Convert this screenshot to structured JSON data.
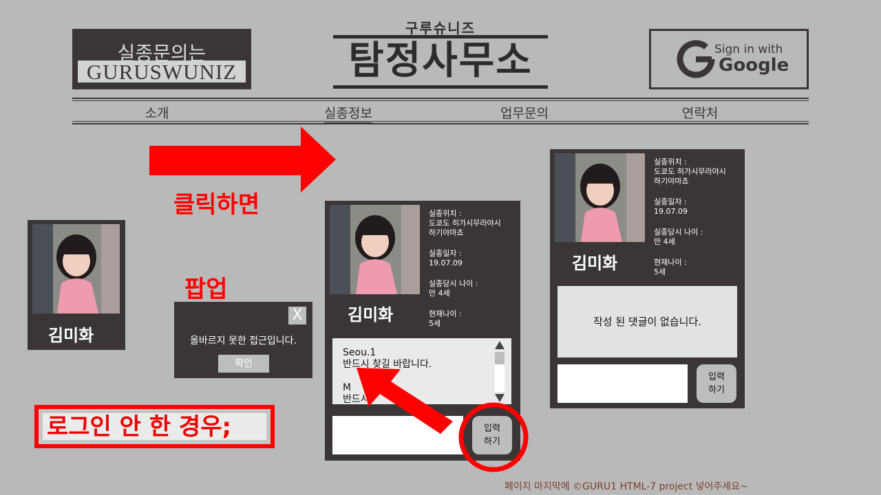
{
  "header": {
    "logo_line1": "실종문의는",
    "logo_line2": "GURUSWUNIZ",
    "brand_subtitle": "구루슈니즈",
    "brand_title": "탐정사무소",
    "signin_line1": "Sign in with",
    "signin_line2": "Google"
  },
  "nav": [
    "소개",
    "실종정보",
    "업무문의",
    "연락처"
  ],
  "annotations": {
    "click_label": "클릭하면",
    "popup_label": "팝업",
    "not_logged_in_label": "로그인 안 한 경우;"
  },
  "small_card": {
    "name": "김미화"
  },
  "popup": {
    "close_label": "X",
    "message": "올바르지 못한 접근입니다.",
    "ok_label": "확인"
  },
  "missing_card": {
    "name": "김미화",
    "location_label": "실종위치 :",
    "location_value_1": "도쿄도 히가시무라야시",
    "location_value_2": "하기야마쵸",
    "date_label": "실종일자 :",
    "date_value": "19.07.09",
    "age_at_label": "실종당시 나이 :",
    "age_at_value": "만 4세",
    "age_now_label": "현재나이 :",
    "age_now_value": "5세"
  },
  "comments": {
    "c1_user": "Seou.1",
    "c1_text": "반드시 찾길 바랍니다.",
    "c2_user": "M",
    "c2_text": "반드시"
  },
  "submit_label_1": "입력",
  "submit_label_2": "하기",
  "no_comments_text": "작성 된 댓글이 없습니다.",
  "footer_text": "페이지 마지막에 ©GURU1 HTML-7 project 넣어주세요~",
  "colors": {
    "accent_red": "#ff0000",
    "card_bg": "#3b3636",
    "page_bg": "#b9b9b9"
  }
}
